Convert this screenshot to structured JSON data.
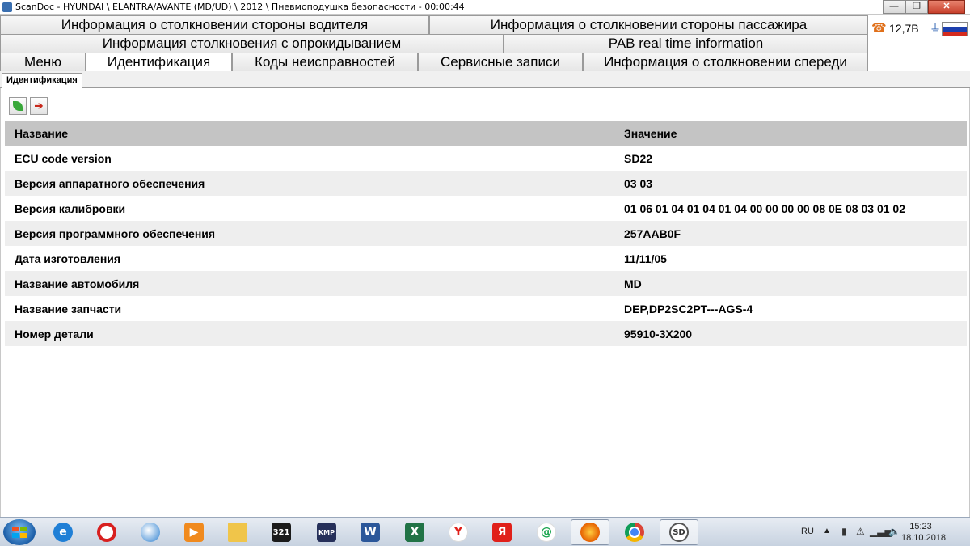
{
  "window": {
    "title": "ScanDoc - HYUNDAI \\ ELANTRA/AVANTE (MD/UD) \\ 2012 \\ Пневмоподушка безопасности - 00:00:44",
    "minimize": "—",
    "maximize": "❐",
    "close": "✕"
  },
  "tabs": {
    "row1": [
      "Информация о столкновении стороны водителя",
      "Информация о столкновении стороны пассажира"
    ],
    "row2": [
      "Информация столкновения с опрокидыванием",
      "PAB real time information"
    ],
    "row3": [
      "Меню",
      "Идентификация",
      "Коды неисправностей",
      "Сервисные записи",
      "Информация о столкновении спереди"
    ]
  },
  "status": {
    "voltage": "12,7В",
    "phone_icon": "phone-icon",
    "plug_icon": "plug-icon",
    "flag": "ru"
  },
  "subtab": {
    "label": "Идентификация"
  },
  "table": {
    "headers": [
      "Название",
      "Значение"
    ],
    "rows": [
      [
        "ECU code version",
        "SD22"
      ],
      [
        "Версия аппаратного обеспечения",
        "03 03"
      ],
      [
        "Версия калибровки",
        "01 06 01 04 01 04 01 04 00 00 00 00 08 0E 08 03 01 02"
      ],
      [
        "Версия программного обеспечения",
        "257AAB0F"
      ],
      [
        "Дата изготовления",
        "11/11/05"
      ],
      [
        "Название автомобиля",
        "MD"
      ],
      [
        "Название запчасти",
        "DEP,DP2SC2PT---AGS-4"
      ],
      [
        "Номер детали",
        "95910-3X200"
      ]
    ]
  },
  "taskbar": {
    "apps": [
      {
        "name": "internet-explorer",
        "glyph": "e"
      },
      {
        "name": "opera",
        "glyph": "O"
      },
      {
        "name": "windows-media-player",
        "glyph": "▶"
      },
      {
        "name": "media-player",
        "glyph": "▶"
      },
      {
        "name": "file-explorer",
        "glyph": "▬"
      },
      {
        "name": "321-player",
        "glyph": "321"
      },
      {
        "name": "kmplayer",
        "glyph": "KMP"
      },
      {
        "name": "word",
        "glyph": "W"
      },
      {
        "name": "excel",
        "glyph": "X"
      },
      {
        "name": "yandex-browser",
        "glyph": "Y"
      },
      {
        "name": "yandex",
        "glyph": "Я"
      },
      {
        "name": "mail-agent",
        "glyph": "@"
      },
      {
        "name": "firefox",
        "glyph": "●"
      },
      {
        "name": "chrome",
        "glyph": ""
      },
      {
        "name": "scandoc",
        "glyph": "SD"
      }
    ],
    "tray": {
      "lang": "RU",
      "time": "15:23",
      "date": "18.10.2018"
    }
  }
}
